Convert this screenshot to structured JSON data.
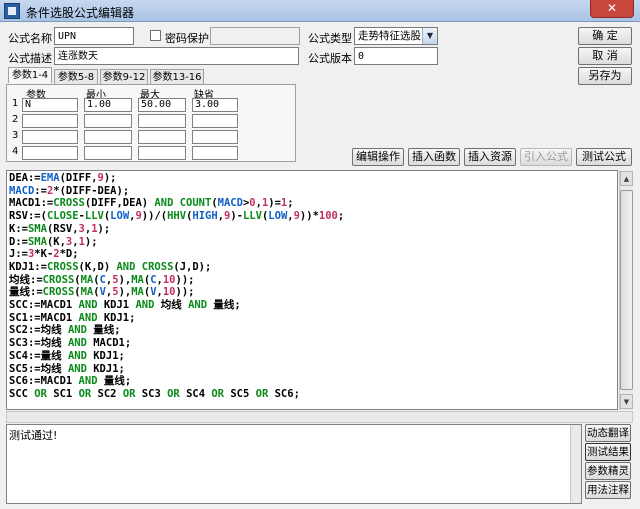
{
  "window": {
    "title": "条件选股公式编辑器",
    "close_label": "✕"
  },
  "form": {
    "name_label": "公式名称",
    "name_value": "UPN",
    "password_label": "密码保护",
    "password_value": "",
    "type_label": "公式类型",
    "type_value": "走势特征选股",
    "desc_label": "公式描述",
    "desc_value": "连涨数天",
    "version_label": "公式版本",
    "version_value": "0"
  },
  "buttons": {
    "ok": "确  定",
    "cancel": "取  消",
    "save_as": "另存为"
  },
  "tabs": [
    "参数1-4",
    "参数5-8",
    "参数9-12",
    "参数13-16"
  ],
  "params": {
    "headers": [
      "参数",
      "最小",
      "最大",
      "缺省"
    ],
    "rows": [
      {
        "num": "1",
        "name": "N",
        "min": "1.00",
        "max": "50.00",
        "def": "3.00"
      },
      {
        "num": "2",
        "name": "",
        "min": "",
        "max": "",
        "def": ""
      },
      {
        "num": "3",
        "name": "",
        "min": "",
        "max": "",
        "def": ""
      },
      {
        "num": "4",
        "name": "",
        "min": "",
        "max": "",
        "def": ""
      }
    ]
  },
  "editor_buttons": [
    "编辑操作",
    "插入函数",
    "插入资源",
    "引入公式",
    "测试公式"
  ],
  "code_lines": [
    [
      [
        "DEA:=",
        "pl"
      ],
      [
        "EMA",
        "ind"
      ],
      [
        "(DIFF,",
        "pl"
      ],
      [
        "9",
        "num"
      ],
      [
        ");",
        "pl"
      ]
    ],
    [
      [
        "MACD",
        "ind"
      ],
      [
        ":=",
        "pl"
      ],
      [
        "2",
        "num"
      ],
      [
        "*(DIFF-DEA);",
        "pl"
      ]
    ],
    [
      [
        "MACD1:=",
        "pl"
      ],
      [
        "CROSS",
        "fn"
      ],
      [
        "(DIFF,DEA) ",
        "pl"
      ],
      [
        "AND",
        "kw"
      ],
      [
        " ",
        "pl"
      ],
      [
        "COUNT",
        "fn"
      ],
      [
        "(",
        "pl"
      ],
      [
        "MACD",
        "ind"
      ],
      [
        ">",
        "pl"
      ],
      [
        "0",
        "num"
      ],
      [
        ",",
        "pl"
      ],
      [
        "1",
        "num"
      ],
      [
        ")=",
        "pl"
      ],
      [
        "1",
        "num"
      ],
      [
        ";",
        "pl"
      ]
    ],
    [
      [
        "RSV:=(",
        "pl"
      ],
      [
        "CLOSE",
        "fn"
      ],
      [
        "-",
        "pl"
      ],
      [
        "LLV",
        "fn"
      ],
      [
        "(",
        "pl"
      ],
      [
        "LOW",
        "ind"
      ],
      [
        ",",
        "pl"
      ],
      [
        "9",
        "num"
      ],
      [
        "))/(",
        "pl"
      ],
      [
        "HHV",
        "fn"
      ],
      [
        "(",
        "pl"
      ],
      [
        "HIGH",
        "ind"
      ],
      [
        ",",
        "pl"
      ],
      [
        "9",
        "num"
      ],
      [
        ")-",
        "pl"
      ],
      [
        "LLV",
        "fn"
      ],
      [
        "(",
        "pl"
      ],
      [
        "LOW",
        "ind"
      ],
      [
        ",",
        "pl"
      ],
      [
        "9",
        "num"
      ],
      [
        "))*",
        "pl"
      ],
      [
        "100",
        "num"
      ],
      [
        ";",
        "pl"
      ]
    ],
    [
      [
        "K:=",
        "pl"
      ],
      [
        "SMA",
        "fn"
      ],
      [
        "(RSV,",
        "pl"
      ],
      [
        "3",
        "num"
      ],
      [
        ",",
        "pl"
      ],
      [
        "1",
        "num"
      ],
      [
        ");",
        "pl"
      ]
    ],
    [
      [
        "D:=",
        "pl"
      ],
      [
        "SMA",
        "fn"
      ],
      [
        "(K,",
        "pl"
      ],
      [
        "3",
        "num"
      ],
      [
        ",",
        "pl"
      ],
      [
        "1",
        "num"
      ],
      [
        ");",
        "pl"
      ]
    ],
    [
      [
        "J:=",
        "pl"
      ],
      [
        "3",
        "num"
      ],
      [
        "*K-",
        "pl"
      ],
      [
        "2",
        "num"
      ],
      [
        "*D;",
        "pl"
      ]
    ],
    [
      [
        "KDJ1:=",
        "pl"
      ],
      [
        "CROSS",
        "fn"
      ],
      [
        "(K,D) ",
        "pl"
      ],
      [
        "AND",
        "kw"
      ],
      [
        " ",
        "pl"
      ],
      [
        "CROSS",
        "fn"
      ],
      [
        "(J,D);",
        "pl"
      ]
    ],
    [
      [
        "均线:=",
        "pl"
      ],
      [
        "CROSS",
        "fn"
      ],
      [
        "(",
        "pl"
      ],
      [
        "MA",
        "fn"
      ],
      [
        "(",
        "pl"
      ],
      [
        "C",
        "ind"
      ],
      [
        ",",
        "pl"
      ],
      [
        "5",
        "num"
      ],
      [
        "),",
        "pl"
      ],
      [
        "MA",
        "fn"
      ],
      [
        "(",
        "pl"
      ],
      [
        "C",
        "ind"
      ],
      [
        ",",
        "pl"
      ],
      [
        "10",
        "num"
      ],
      [
        "));",
        "pl"
      ]
    ],
    [
      [
        "量线:=",
        "pl"
      ],
      [
        "CROSS",
        "fn"
      ],
      [
        "(",
        "pl"
      ],
      [
        "MA",
        "fn"
      ],
      [
        "(",
        "pl"
      ],
      [
        "V",
        "ind"
      ],
      [
        ",",
        "pl"
      ],
      [
        "5",
        "num"
      ],
      [
        "),",
        "pl"
      ],
      [
        "MA",
        "fn"
      ],
      [
        "(",
        "pl"
      ],
      [
        "V",
        "ind"
      ],
      [
        ",",
        "pl"
      ],
      [
        "10",
        "num"
      ],
      [
        "));",
        "pl"
      ]
    ],
    [
      [
        "SCC:=MACD1 ",
        "pl"
      ],
      [
        "AND",
        "kw"
      ],
      [
        " KDJ1 ",
        "pl"
      ],
      [
        "AND",
        "kw"
      ],
      [
        " 均线 ",
        "pl"
      ],
      [
        "AND",
        "kw"
      ],
      [
        " 量线;",
        "pl"
      ]
    ],
    [
      [
        "SC1:=MACD1 ",
        "pl"
      ],
      [
        "AND",
        "kw"
      ],
      [
        " KDJ1;",
        "pl"
      ]
    ],
    [
      [
        "SC2:=均线 ",
        "pl"
      ],
      [
        "AND",
        "kw"
      ],
      [
        " 量线;",
        "pl"
      ]
    ],
    [
      [
        "SC3:=均线 ",
        "pl"
      ],
      [
        "AND",
        "kw"
      ],
      [
        " MACD1;",
        "pl"
      ]
    ],
    [
      [
        "SC4:=量线 ",
        "pl"
      ],
      [
        "AND",
        "kw"
      ],
      [
        " KDJ1;",
        "pl"
      ]
    ],
    [
      [
        "SC5:=均线 ",
        "pl"
      ],
      [
        "AND",
        "kw"
      ],
      [
        " KDJ1;",
        "pl"
      ]
    ],
    [
      [
        "SC6:=MACD1 ",
        "pl"
      ],
      [
        "AND",
        "kw"
      ],
      [
        " 量线;",
        "pl"
      ]
    ],
    [
      [
        "SCC ",
        "pl"
      ],
      [
        "OR",
        "kw"
      ],
      [
        " SC1 ",
        "pl"
      ],
      [
        "OR",
        "kw"
      ],
      [
        " SC2 ",
        "pl"
      ],
      [
        "OR",
        "kw"
      ],
      [
        " SC3 ",
        "pl"
      ],
      [
        "OR",
        "kw"
      ],
      [
        " SC4 ",
        "pl"
      ],
      [
        "OR",
        "kw"
      ],
      [
        " SC5 ",
        "pl"
      ],
      [
        "OR",
        "kw"
      ],
      [
        " SC6;",
        "pl"
      ]
    ]
  ],
  "output_text": "测试通过!",
  "side_buttons": [
    "动态翻译",
    "测试结果",
    "参数精灵",
    "用法注释"
  ],
  "colors": {
    "keyword": "#0a8a1a",
    "number": "#c03060",
    "indicator": "#1060c8",
    "close": "#c9463d"
  }
}
